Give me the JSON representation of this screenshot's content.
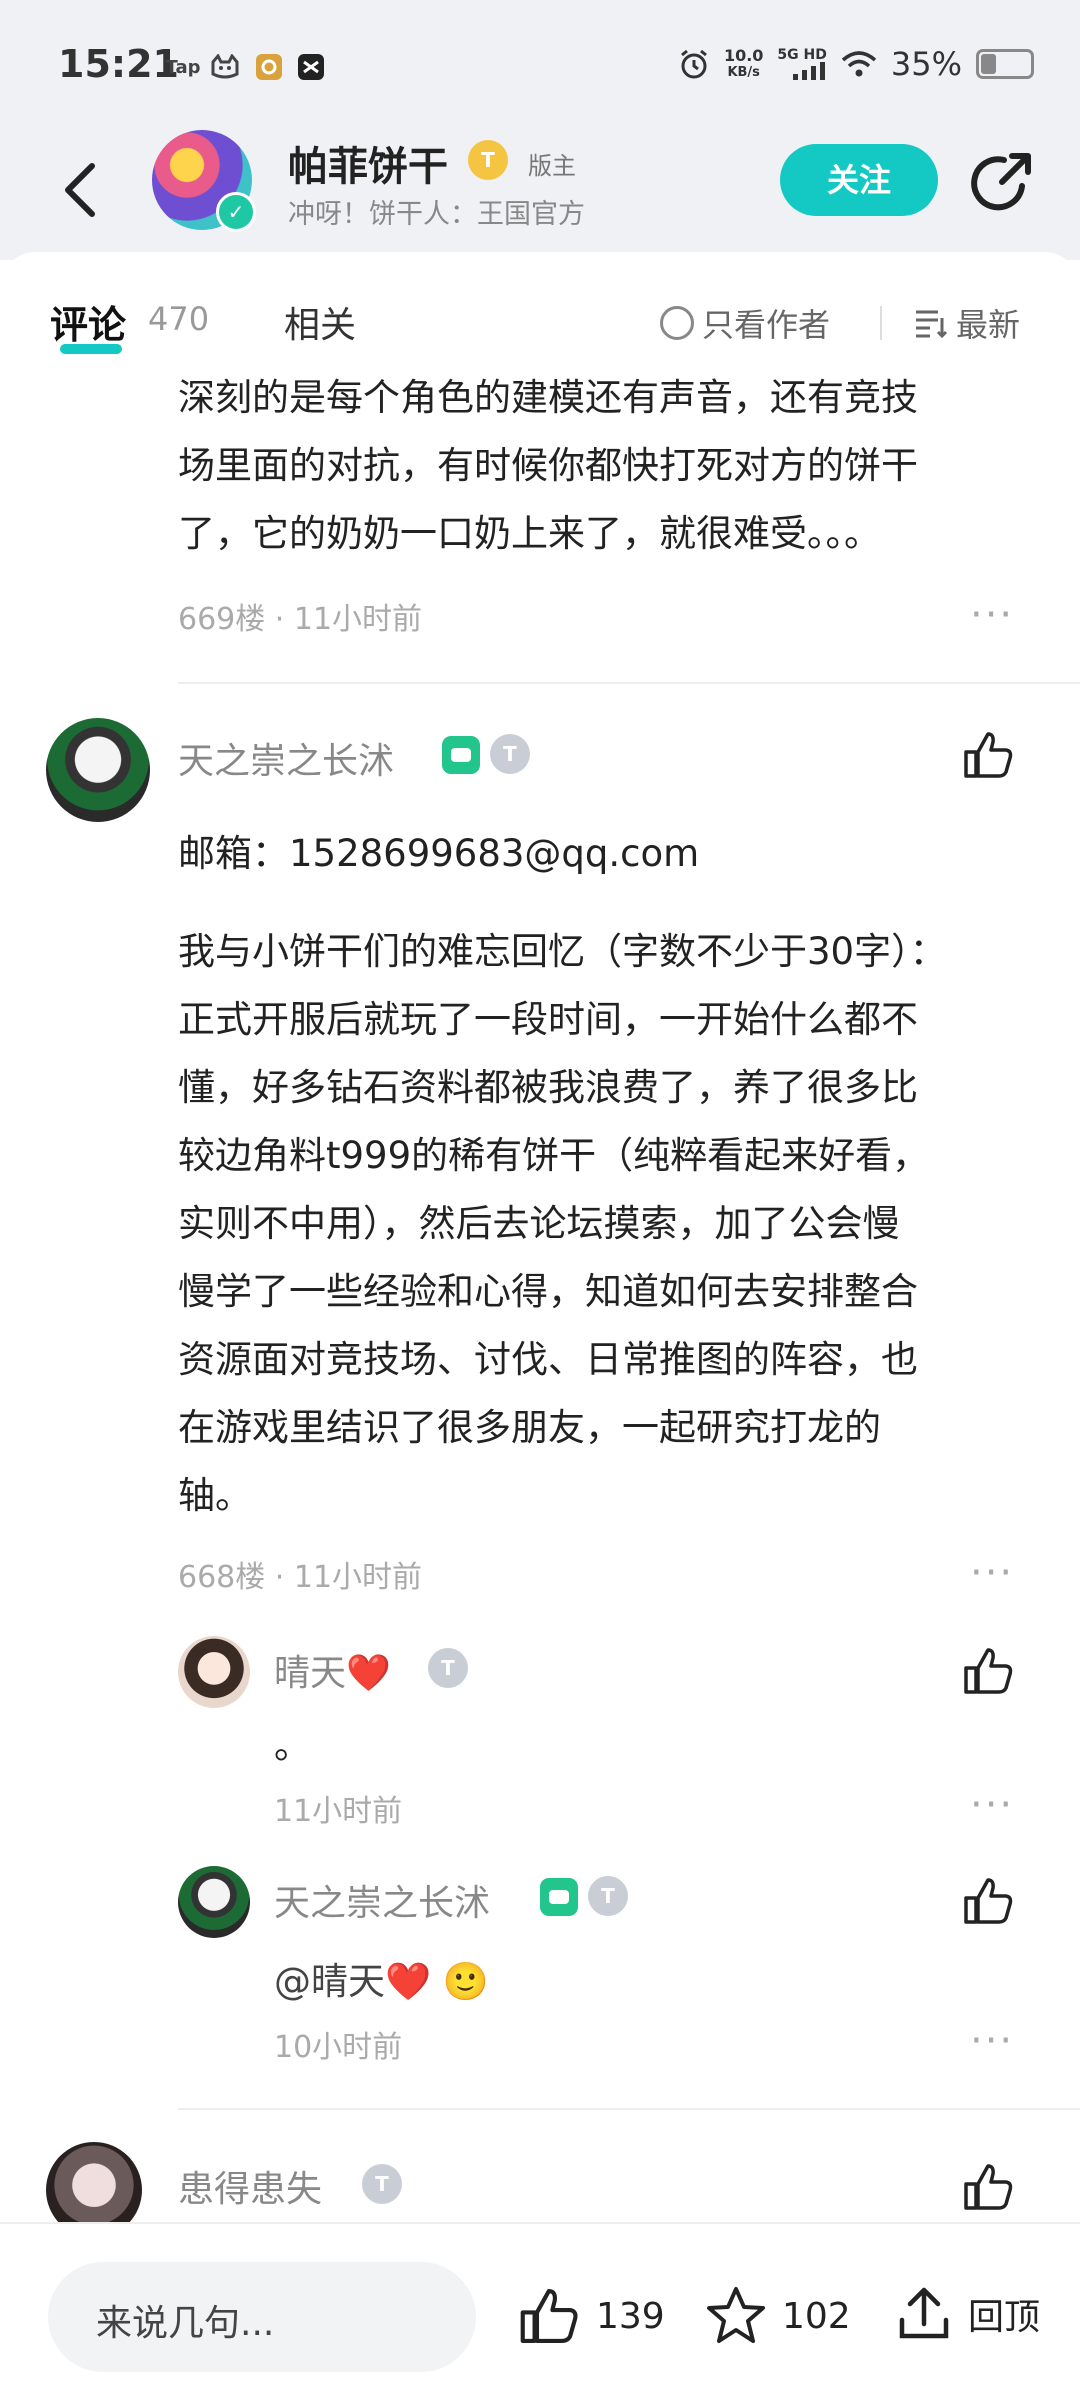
{
  "status_bar": {
    "time": "15:21",
    "apps": [
      "TapTap",
      "cat",
      "app",
      "app2"
    ],
    "speed_top": "10.0",
    "speed_bottom": "KB/s",
    "signal": "5G HD",
    "battery": "35%",
    "battery_level": 0.35
  },
  "header": {
    "name": "帕菲饼干",
    "level_badge": "T",
    "role": "版主",
    "subtitle": "冲呀！饼干人：王国官方",
    "follow_label": "关注"
  },
  "tabs": {
    "comments_label": "评论",
    "comments_count": "470",
    "related_label": "相关",
    "author_only_label": "只看作者",
    "sort_label": "最新"
  },
  "comments": [
    {
      "text_lines": [
        "深刻的是每个角色的建模还有声音，还有竞技",
        "场里面的对抗，有时候你都快打死对方的饼干",
        "了，它的奶奶一口奶上来了，就很难受。。。"
      ],
      "meta": "669楼 · 11小时前"
    },
    {
      "user": "天之崇之长沭",
      "email_line": "邮箱：1528699683@qq.com",
      "body_lines": [
        "我与小饼干们的难忘回忆（字数不少于30字）：",
        "正式开服后就玩了一段时间，一开始什么都不",
        "懂，好多钻石资料都被我浪费了，养了很多比",
        "较边角料t999的稀有饼干（纯粹看起来好看，",
        "实则不中用），然后去论坛摸索，加了公会慢",
        "慢学了一些经验和心得，知道如何去安排整合",
        "资源面对竞技场、讨伐、日常推图的阵容，也",
        "在游戏里结识了很多朋友，一起研究打龙的",
        "轴。"
      ],
      "meta": "668楼 · 11小时前",
      "replies": [
        {
          "user": "晴天❤️",
          "text": "。",
          "meta": "11小时前"
        },
        {
          "user": "天之崇之长沭",
          "text": "@晴天❤️ 🙂",
          "meta": "10小时前"
        }
      ]
    },
    {
      "user": "患得患失"
    }
  ],
  "bottom_bar": {
    "input_placeholder": "来说几句...",
    "likes": "139",
    "favorites": "102",
    "back_top": "回顶"
  }
}
